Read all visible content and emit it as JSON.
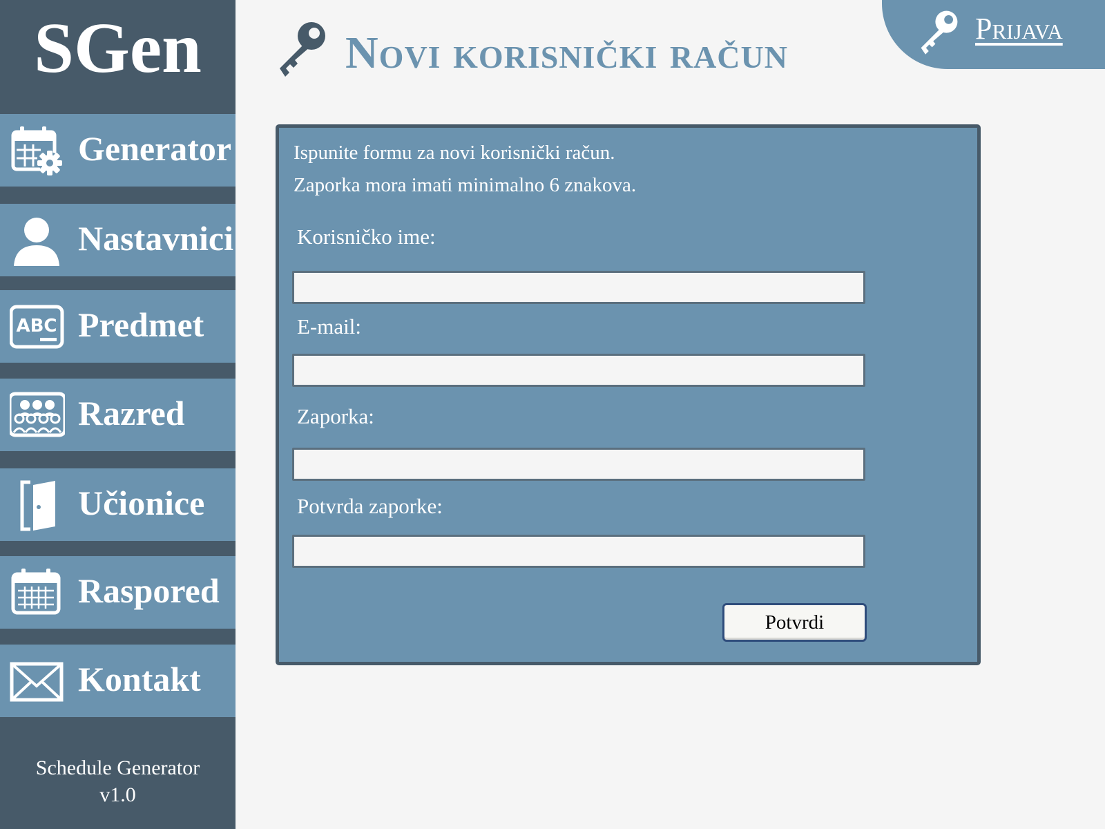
{
  "app": {
    "logo": "SGen",
    "footer_line1": "Schedule Generator",
    "footer_line2": "v1.0"
  },
  "sidebar": {
    "items": [
      {
        "label": "Generator",
        "icon": "calendar-gear-icon"
      },
      {
        "label": "Nastavnici",
        "icon": "user-icon"
      },
      {
        "label": "Predmet",
        "icon": "abc-board-icon"
      },
      {
        "label": "Razred",
        "icon": "group-icon"
      },
      {
        "label": "Učionice",
        "icon": "door-icon"
      },
      {
        "label": "Raspored",
        "icon": "calendar-icon"
      },
      {
        "label": "Kontakt",
        "icon": "envelope-icon"
      }
    ]
  },
  "header": {
    "title": "Novi korisnički račun",
    "title_icon": "key-icon",
    "login_label": "Prijava",
    "login_icon": "key-icon"
  },
  "form": {
    "intro_line1": "Ispunite formu za novi korisnički račun.",
    "intro_line2": "Zaporka mora imati minimalno 6 znakova.",
    "fields": [
      {
        "label": "Korisničko ime:",
        "value": "",
        "placeholder": ""
      },
      {
        "label": "E-mail:",
        "value": "",
        "placeholder": ""
      },
      {
        "label": "Zaporka:",
        "value": "",
        "placeholder": ""
      },
      {
        "label": "Potvrda zaporke:",
        "value": "",
        "placeholder": ""
      }
    ],
    "submit_label": "Potvrdi"
  },
  "colors": {
    "sidebar_dark": "#475a69",
    "accent_blue": "#6b93af",
    "page_background": "#f5f5f5"
  }
}
